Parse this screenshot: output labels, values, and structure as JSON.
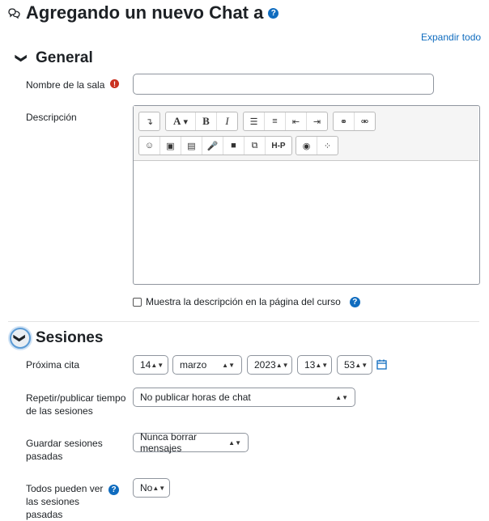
{
  "header": {
    "title": "Agregando un nuevo Chat a",
    "title_icon": "chat-icon",
    "expand_all": "Expandir todo"
  },
  "general": {
    "heading": "General",
    "room_name_label": "Nombre de la sala",
    "room_name_value": "",
    "description_label": "Descripción",
    "show_description_label": "Muestra la descripción en la página del curso"
  },
  "sessions": {
    "heading": "Sesiones",
    "next_label": "Próxima cita",
    "day": "14",
    "month": "marzo",
    "year": "2023",
    "hour": "13",
    "minute": "53",
    "repeat_label": "Repetir/publicar tiempo de las sesiones",
    "repeat_value": "No publicar horas de chat",
    "keep_label": "Guardar sesiones pasadas",
    "keep_value": "Nunca borrar mensajes",
    "everyone_label": "Todos pueden ver las sesiones pasadas",
    "everyone_value": "No"
  },
  "toolbar": {
    "hp": "H-P"
  },
  "colors": {
    "accent": "#0f6cbf",
    "required": "#ca3120"
  }
}
